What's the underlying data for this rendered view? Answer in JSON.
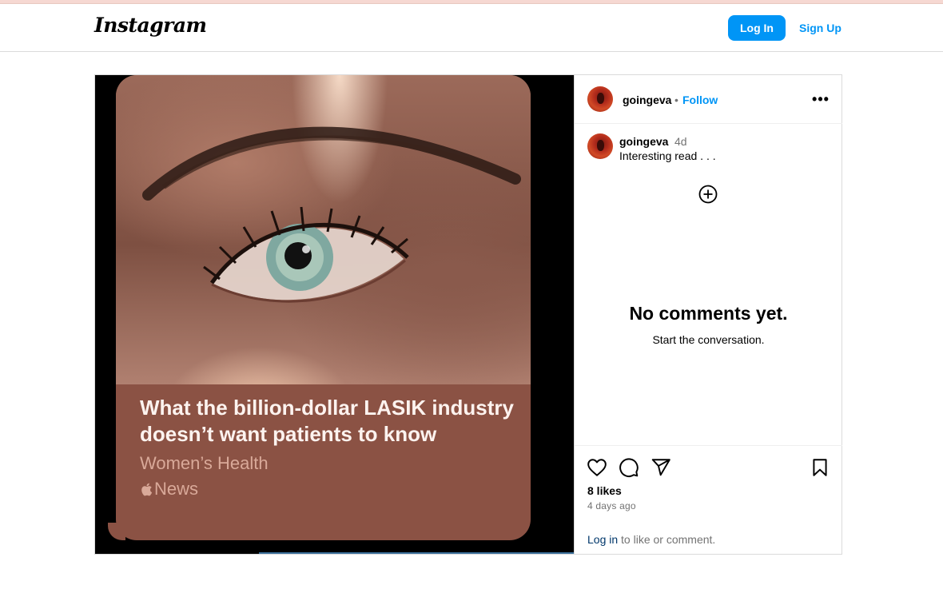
{
  "header": {
    "logo_text": "Instagram",
    "login_label": "Log In",
    "signup_label": "Sign Up"
  },
  "post": {
    "author": "goingeva",
    "follow_separator": "•",
    "follow_label": "Follow",
    "more_icon": "more-horizontal-icon",
    "caption": {
      "user": "goingeva",
      "time": "4d",
      "text": "Interesting read . . ."
    },
    "card": {
      "headline": "What the billion-dollar LASIK industry doesn’t want patients to know",
      "publisher": "Women’s Health",
      "brand": "News",
      "brand_icon": "apple-logo-icon"
    },
    "comments": {
      "empty_title": "No comments yet.",
      "empty_subtitle": "Start the conversation."
    },
    "likes": "8 likes",
    "posted": "4 days ago",
    "login_prompt": {
      "link": "Log in",
      "text": " to like or comment."
    }
  },
  "colors": {
    "accent": "#0095f6",
    "card_background": "#8b5244",
    "border": "#dbdbdb"
  }
}
